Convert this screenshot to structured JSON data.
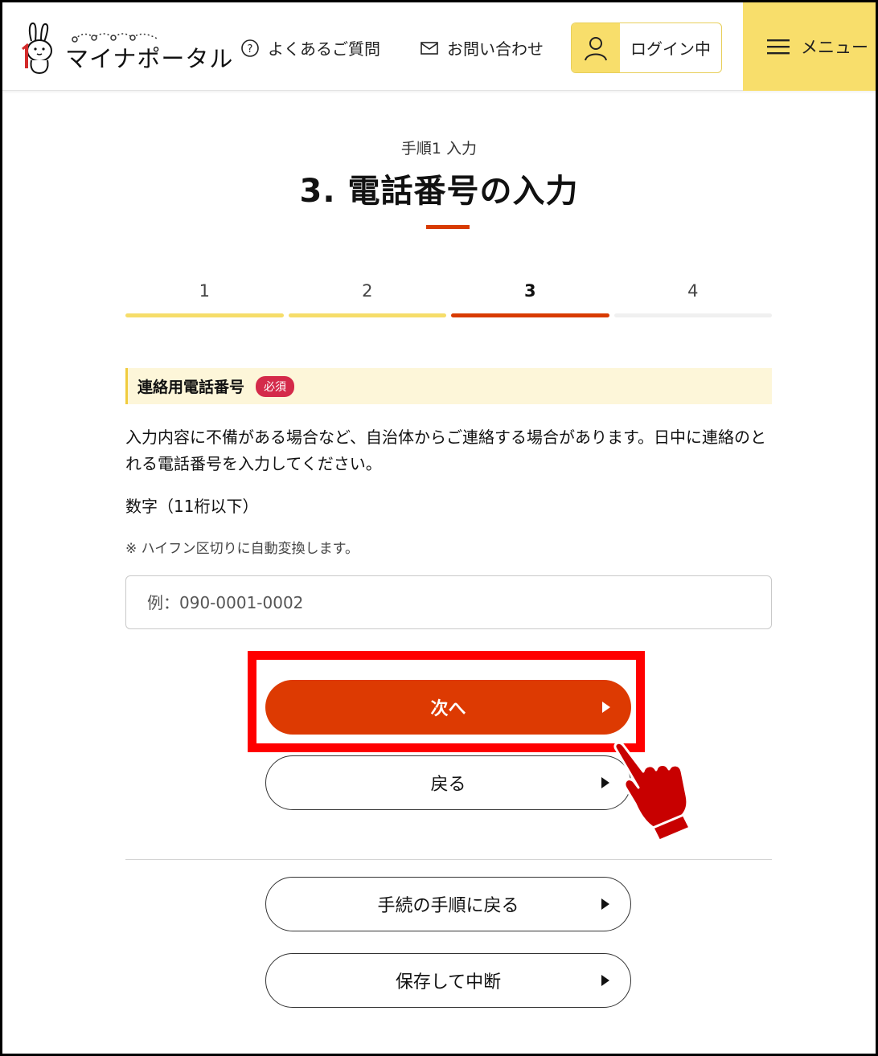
{
  "header": {
    "logo_text": "マイナポータル",
    "faq_label": "よくあるご質問",
    "contact_label": "お問い合わせ",
    "login_label": "ログイン中",
    "menu_label": "メニュー"
  },
  "page": {
    "step_small": "手順1 入力",
    "title": "3. 電話番号の入力"
  },
  "stepper": {
    "steps": [
      {
        "label": "1",
        "state": "done"
      },
      {
        "label": "2",
        "state": "done"
      },
      {
        "label": "3",
        "state": "current"
      },
      {
        "label": "4",
        "state": "todo"
      }
    ],
    "colors": {
      "done": "#f6dd6a",
      "current": "#d83b01",
      "todo": "#f0f0f0"
    }
  },
  "form": {
    "section_label": "連絡用電話番号",
    "required_badge": "必須",
    "description": "入力内容に不備がある場合など、自治体からご連絡する場合があります。日中に連絡のとれる電話番号を入力してください。",
    "format": "数字（11桁以下）",
    "note": "※ ハイフン区切りに自動変換します。",
    "phone_value": "",
    "phone_placeholder": "例：090-0001-0002"
  },
  "buttons": {
    "next_label": "次へ",
    "back_label": "戻る",
    "procedure_label": "手続の手順に戻る",
    "save_label": "保存して中断"
  },
  "colors": {
    "accent_red": "#dd3a02",
    "brand_yellow": "#f8de6b",
    "highlight_red": "#ff0000"
  }
}
